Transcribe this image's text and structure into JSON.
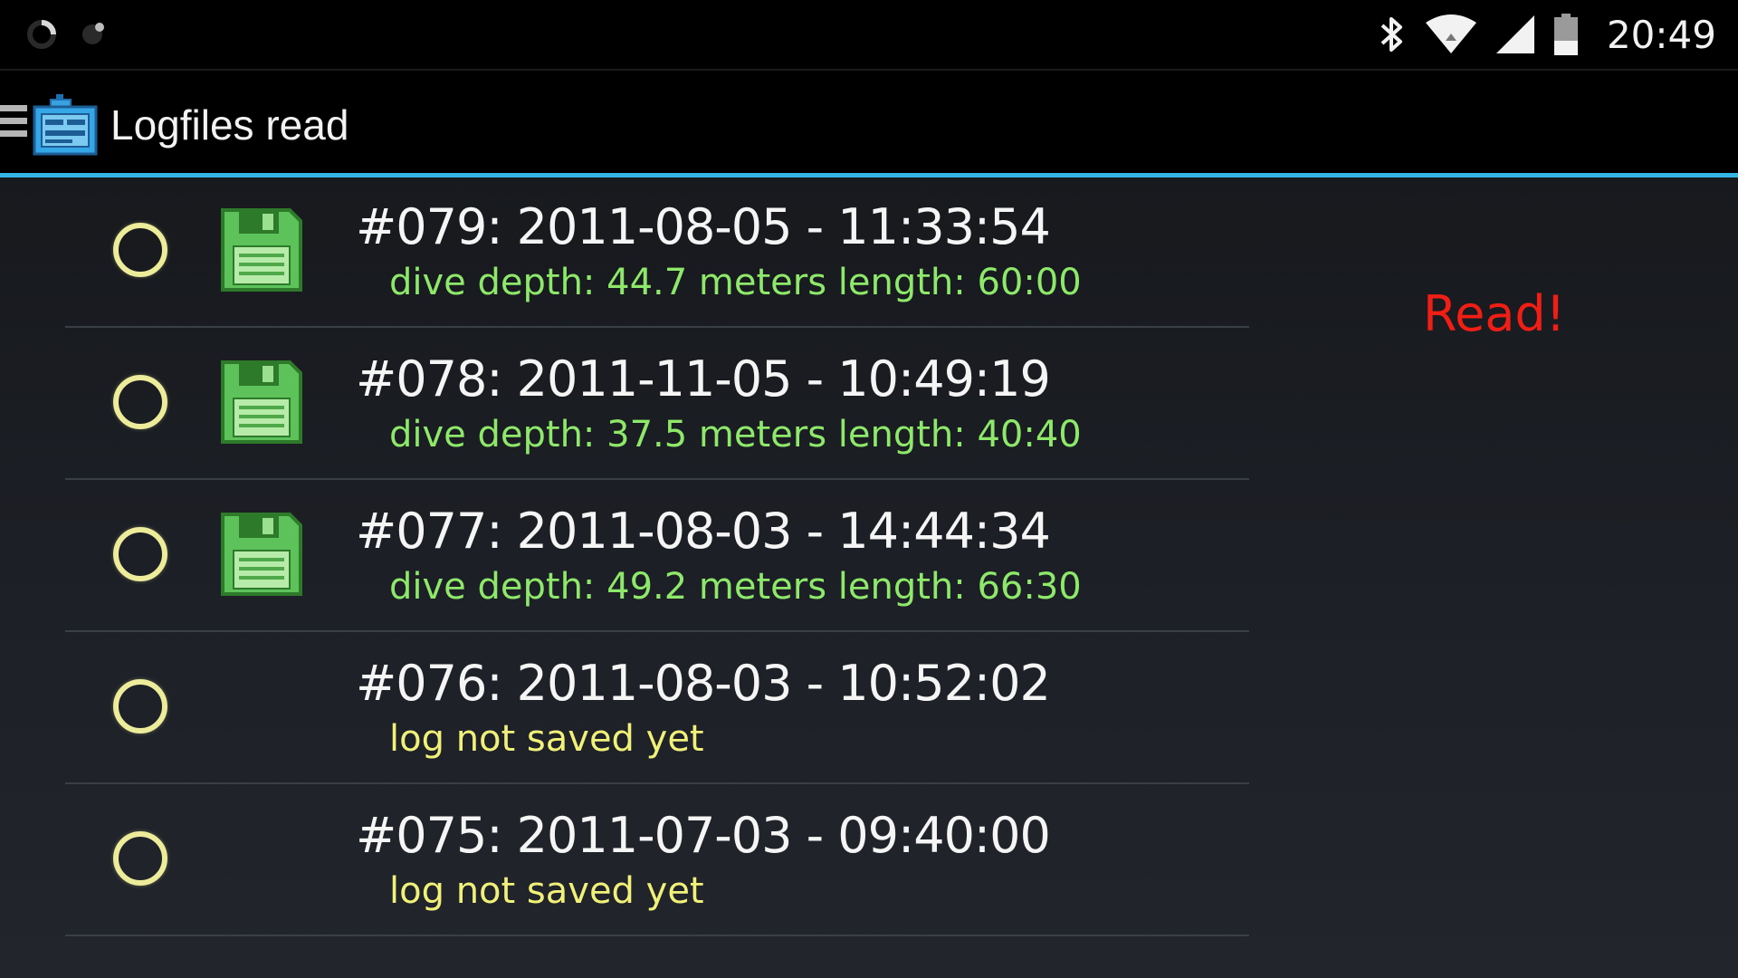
{
  "status_bar": {
    "time": "20:49",
    "icons": [
      "sync-icon",
      "notification-icon",
      "bluetooth-icon",
      "wifi-icon",
      "cell-signal-icon",
      "battery-icon"
    ]
  },
  "action_bar": {
    "title": "Logfiles read",
    "accent_color": "#33b5e5"
  },
  "logs": [
    {
      "title": "#079: 2011-08-05 - 11:33:54",
      "subtitle": "dive depth: 44.7 meters length: 60:00",
      "saved": true
    },
    {
      "title": "#078: 2011-11-05 - 10:49:19",
      "subtitle": "dive depth: 37.5 meters length: 40:40",
      "saved": true
    },
    {
      "title": "#077: 2011-08-03 - 14:44:34",
      "subtitle": "dive depth: 49.2 meters length: 66:30",
      "saved": true
    },
    {
      "title": "#076: 2011-08-03 - 10:52:02",
      "subtitle": "log not saved yet",
      "saved": false
    },
    {
      "title": "#075: 2011-07-03 - 09:40:00",
      "subtitle": "log not saved yet",
      "saved": false
    }
  ],
  "status_message": {
    "text": "Read!",
    "color": "#f01e14"
  },
  "colors": {
    "saved_text": "#8ee86a",
    "unsaved_text": "#f1f17a",
    "radio": "#ecec9a",
    "floppy": "#5ec25a"
  }
}
